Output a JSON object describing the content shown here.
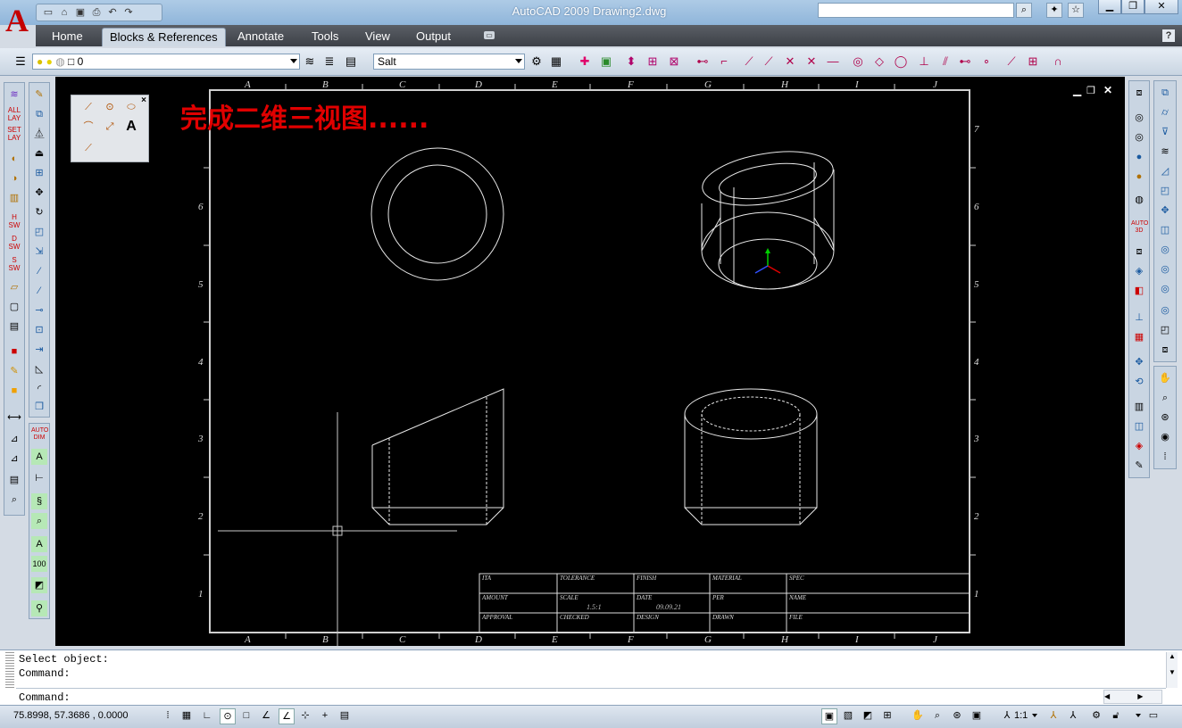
{
  "app": {
    "title": "AutoCAD 2009 Drawing2.dwg",
    "logo_letter": "A",
    "accent": "#c40000"
  },
  "quick_access": {
    "icons": [
      "new-icon",
      "open-icon",
      "save-icon",
      "print-icon",
      "undo-icon",
      "redo-icon"
    ]
  },
  "window_controls": [
    "minimize-icon",
    "restore-icon",
    "close-icon"
  ],
  "search": {
    "placeholder": ""
  },
  "ribbon": {
    "tabs": [
      {
        "label": "Home"
      },
      {
        "label": "Blocks & References",
        "active": true
      },
      {
        "label": "Annotate"
      },
      {
        "label": "Tools"
      },
      {
        "label": "View"
      },
      {
        "label": "Output"
      }
    ]
  },
  "toolbar": {
    "layer_value": "0",
    "textstyle_value": "Salt"
  },
  "drawing": {
    "annotation": "完成二维三视图......",
    "col_labels": [
      "A",
      "B",
      "C",
      "D",
      "E",
      "F",
      "G",
      "H",
      "I",
      "J"
    ],
    "row_labels": [
      "7",
      "6",
      "5",
      "4",
      "3",
      "2",
      "1"
    ],
    "title_block": {
      "r1": [
        "ITA",
        "TOLERANCE",
        "FINISH",
        "MATERIAL",
        "SPEC"
      ],
      "r2": [
        "AMOUNT",
        "SCALE",
        "DATE",
        "PER",
        "NAME"
      ],
      "r3": [
        "APPROVAL",
        "CHECKED",
        "DESIGN",
        "DRAWN",
        "FILE"
      ],
      "scale_value": "1.5:1",
      "date_value": "09.09.21"
    }
  },
  "command": {
    "line1": "Select object:",
    "line2": "Command:",
    "prompt": "Command:"
  },
  "status": {
    "coordinates": "75.8998, 57.3686 , 0.0000",
    "annotation_scale": "1:1"
  }
}
